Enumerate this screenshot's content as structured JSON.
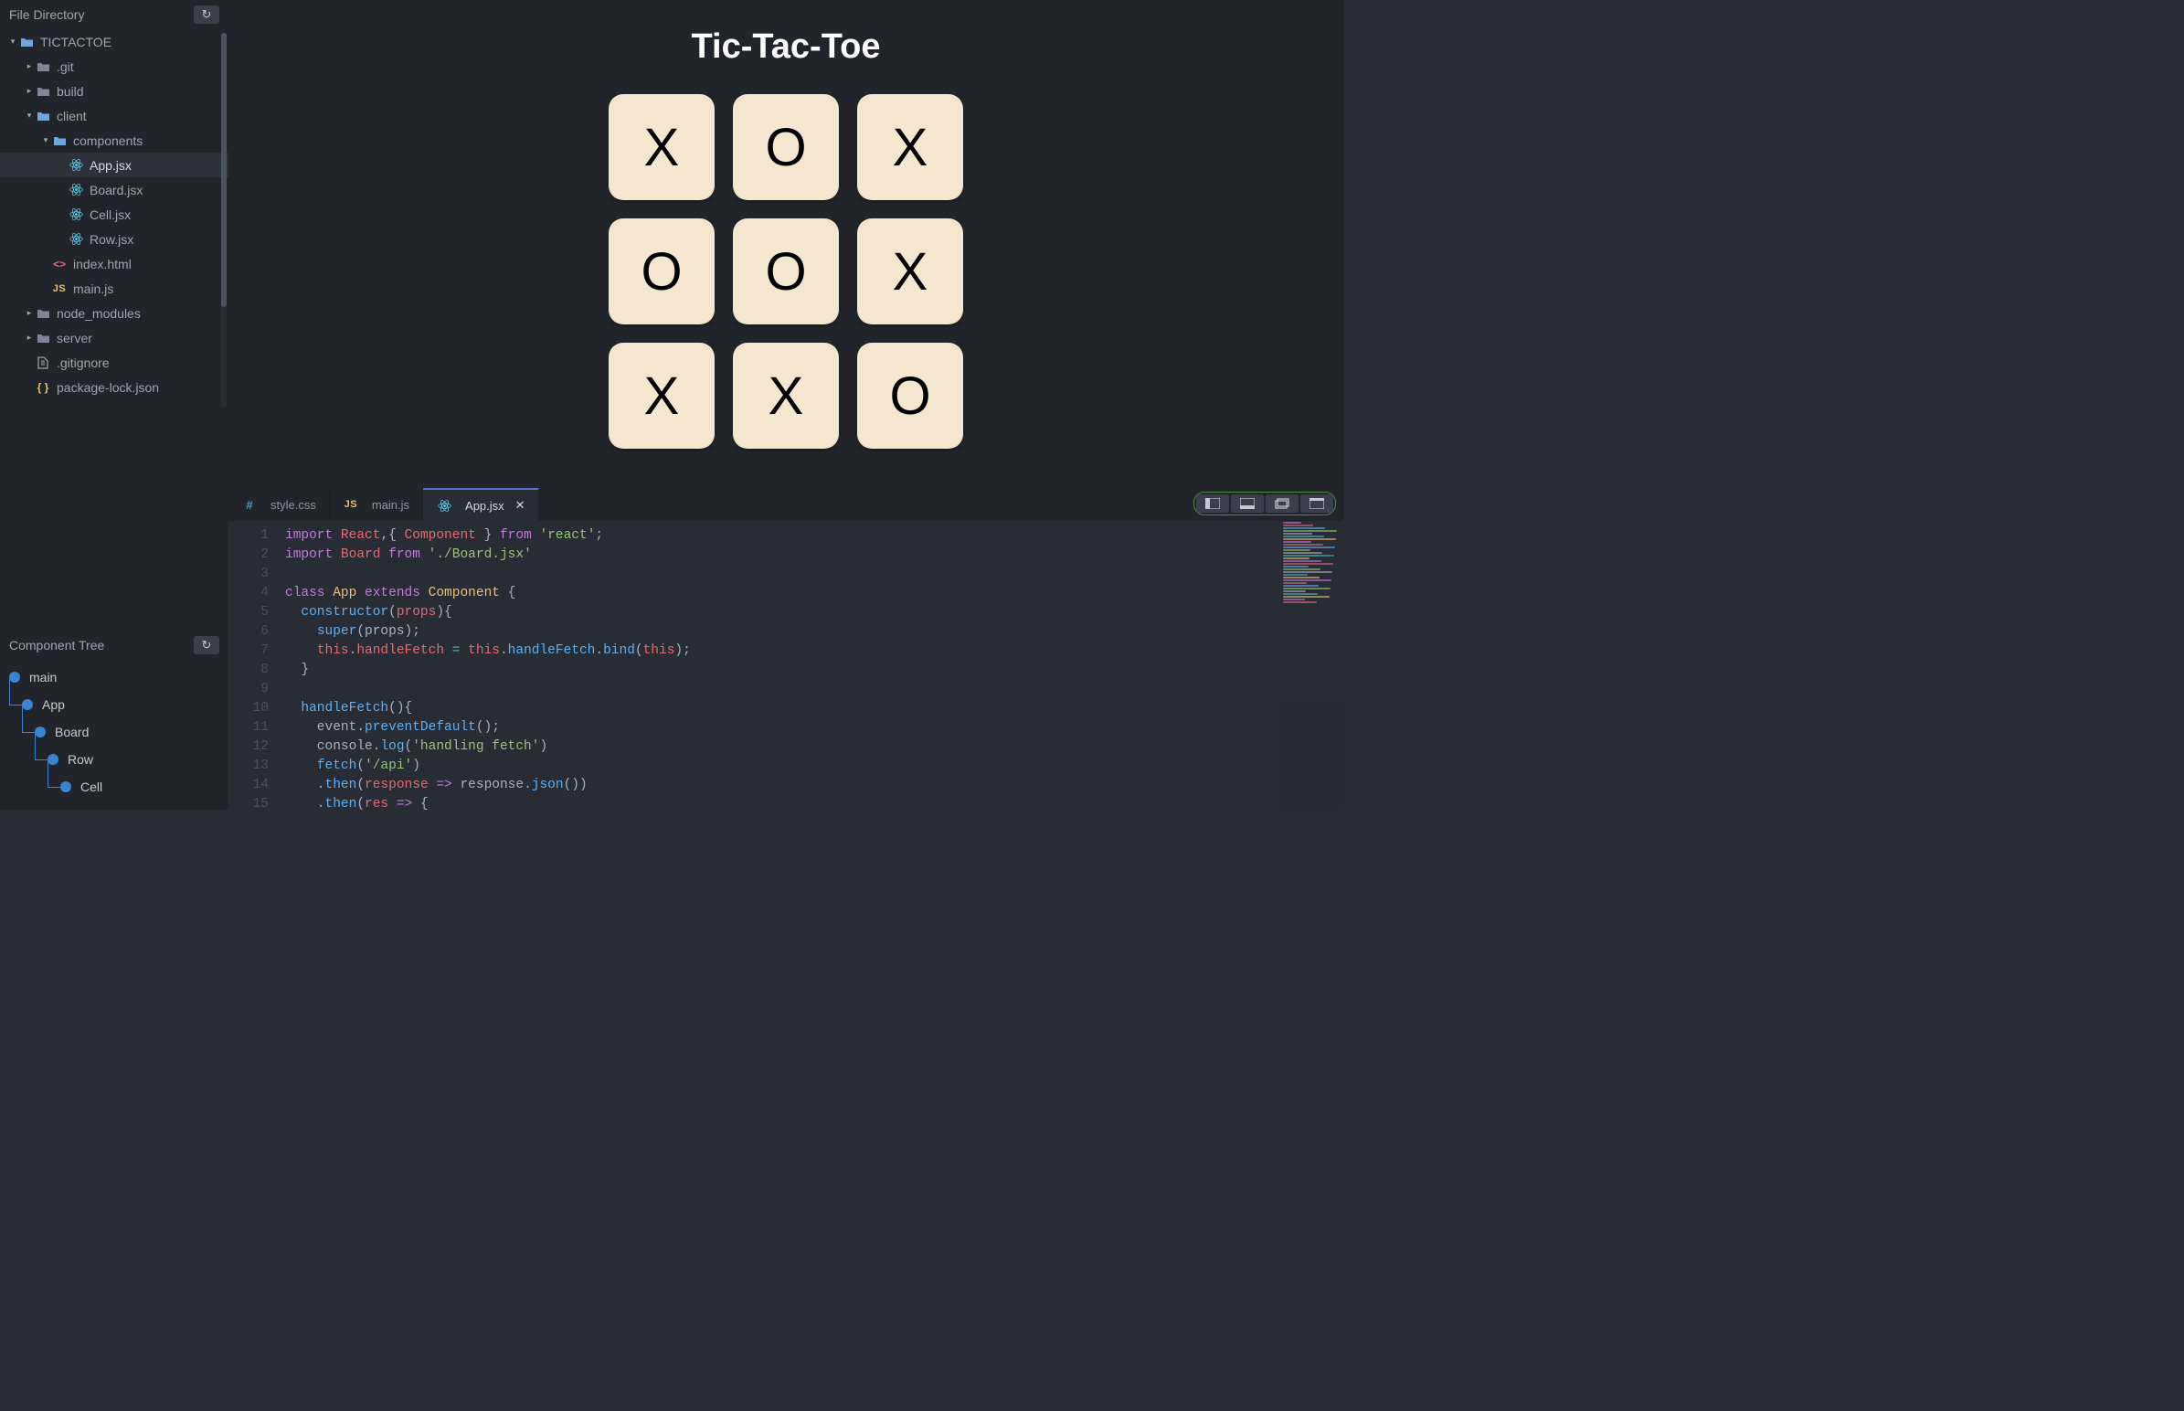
{
  "sidebar": {
    "file_directory_title": "File Directory",
    "component_tree_title": "Component Tree",
    "files": [
      {
        "name": "TICTACTOE",
        "type": "folder-open",
        "depth": 0,
        "arrow": "▾"
      },
      {
        "name": ".git",
        "type": "folder",
        "depth": 1,
        "arrow": "▸"
      },
      {
        "name": "build",
        "type": "folder",
        "depth": 1,
        "arrow": "▸"
      },
      {
        "name": "client",
        "type": "folder-open",
        "depth": 1,
        "arrow": "▾"
      },
      {
        "name": "components",
        "type": "folder-open",
        "depth": 2,
        "arrow": "▾"
      },
      {
        "name": "App.jsx",
        "type": "react",
        "depth": 3,
        "selected": true
      },
      {
        "name": "Board.jsx",
        "type": "react",
        "depth": 3
      },
      {
        "name": "Cell.jsx",
        "type": "react",
        "depth": 3
      },
      {
        "name": "Row.jsx",
        "type": "react",
        "depth": 3
      },
      {
        "name": "index.html",
        "type": "html",
        "depth": 2
      },
      {
        "name": "main.js",
        "type": "js",
        "depth": 2
      },
      {
        "name": "node_modules",
        "type": "folder",
        "depth": 1,
        "arrow": "▸"
      },
      {
        "name": "server",
        "type": "folder",
        "depth": 1,
        "arrow": "▸"
      },
      {
        "name": ".gitignore",
        "type": "file",
        "depth": 1
      },
      {
        "name": "package-lock.json",
        "type": "json",
        "depth": 1
      }
    ],
    "component_tree": [
      {
        "name": "main",
        "depth": 0
      },
      {
        "name": "App",
        "depth": 1
      },
      {
        "name": "Board",
        "depth": 2
      },
      {
        "name": "Row",
        "depth": 3
      },
      {
        "name": "Cell",
        "depth": 4
      }
    ]
  },
  "preview": {
    "title": "Tic-Tac-Toe",
    "cells": [
      "X",
      "O",
      "X",
      "O",
      "O",
      "X",
      "X",
      "X",
      "O"
    ]
  },
  "editor": {
    "tabs": [
      {
        "type": "css",
        "label": "style.css",
        "active": false
      },
      {
        "type": "js",
        "label": "main.js",
        "active": false
      },
      {
        "type": "react",
        "label": "App.jsx",
        "active": true,
        "closable": true
      }
    ],
    "line_start": 1,
    "line_end": 15,
    "code_tokens": [
      [
        [
          "c-kw",
          "import"
        ],
        [
          "c-def",
          " "
        ],
        [
          "c-attr",
          "React"
        ],
        [
          "c-def",
          ",{ "
        ],
        [
          "c-attr",
          "Component"
        ],
        [
          "c-def",
          " } "
        ],
        [
          "c-kw",
          "from"
        ],
        [
          "c-def",
          " "
        ],
        [
          "c-str",
          "'react'"
        ],
        [
          "c-def",
          ";"
        ]
      ],
      [
        [
          "c-kw",
          "import"
        ],
        [
          "c-def",
          " "
        ],
        [
          "c-attr",
          "Board"
        ],
        [
          "c-def",
          " "
        ],
        [
          "c-kw",
          "from"
        ],
        [
          "c-def",
          " "
        ],
        [
          "c-str",
          "'./Board.jsx'"
        ]
      ],
      [],
      [
        [
          "c-kw",
          "class"
        ],
        [
          "c-def",
          " "
        ],
        [
          "c-comp",
          "App"
        ],
        [
          "c-def",
          " "
        ],
        [
          "c-kw",
          "extends"
        ],
        [
          "c-def",
          " "
        ],
        [
          "c-comp",
          "Component"
        ],
        [
          "c-def",
          " {"
        ]
      ],
      [
        [
          "c-def",
          "  "
        ],
        [
          "c-fn",
          "constructor"
        ],
        [
          "c-def",
          "("
        ],
        [
          "c-attr",
          "props"
        ],
        [
          "c-def",
          "){"
        ]
      ],
      [
        [
          "c-def",
          "    "
        ],
        [
          "c-fn",
          "super"
        ],
        [
          "c-def",
          "(props);"
        ]
      ],
      [
        [
          "c-def",
          "    "
        ],
        [
          "c-attr",
          "this"
        ],
        [
          "c-def",
          "."
        ],
        [
          "c-attr",
          "handleFetch"
        ],
        [
          "c-def",
          " "
        ],
        [
          "c-op",
          "="
        ],
        [
          "c-def",
          " "
        ],
        [
          "c-attr",
          "this"
        ],
        [
          "c-def",
          "."
        ],
        [
          "c-fn",
          "handleFetch"
        ],
        [
          "c-def",
          "."
        ],
        [
          "c-fn",
          "bind"
        ],
        [
          "c-def",
          "("
        ],
        [
          "c-attr",
          "this"
        ],
        [
          "c-def",
          ");"
        ]
      ],
      [
        [
          "c-def",
          "  }"
        ]
      ],
      [],
      [
        [
          "c-def",
          "  "
        ],
        [
          "c-fn",
          "handleFetch"
        ],
        [
          "c-def",
          "(){"
        ]
      ],
      [
        [
          "c-def",
          "    event."
        ],
        [
          "c-fn",
          "preventDefault"
        ],
        [
          "c-def",
          "();"
        ]
      ],
      [
        [
          "c-def",
          "    console."
        ],
        [
          "c-fn",
          "log"
        ],
        [
          "c-def",
          "("
        ],
        [
          "c-str",
          "'handling fetch'"
        ],
        [
          "c-def",
          ")"
        ]
      ],
      [
        [
          "c-def",
          "    "
        ],
        [
          "c-fn",
          "fetch"
        ],
        [
          "c-def",
          "("
        ],
        [
          "c-str",
          "'/api'"
        ],
        [
          "c-def",
          ")"
        ]
      ],
      [
        [
          "c-def",
          "    ."
        ],
        [
          "c-fn",
          "then"
        ],
        [
          "c-def",
          "("
        ],
        [
          "c-attr",
          "response"
        ],
        [
          "c-def",
          " "
        ],
        [
          "c-kw",
          "=>"
        ],
        [
          "c-def",
          " response."
        ],
        [
          "c-fn",
          "json"
        ],
        [
          "c-def",
          "())"
        ]
      ],
      [
        [
          "c-def",
          "    ."
        ],
        [
          "c-fn",
          "then"
        ],
        [
          "c-def",
          "("
        ],
        [
          "c-attr",
          "res"
        ],
        [
          "c-def",
          " "
        ],
        [
          "c-kw",
          "=>"
        ],
        [
          "c-def",
          " {"
        ]
      ]
    ]
  }
}
